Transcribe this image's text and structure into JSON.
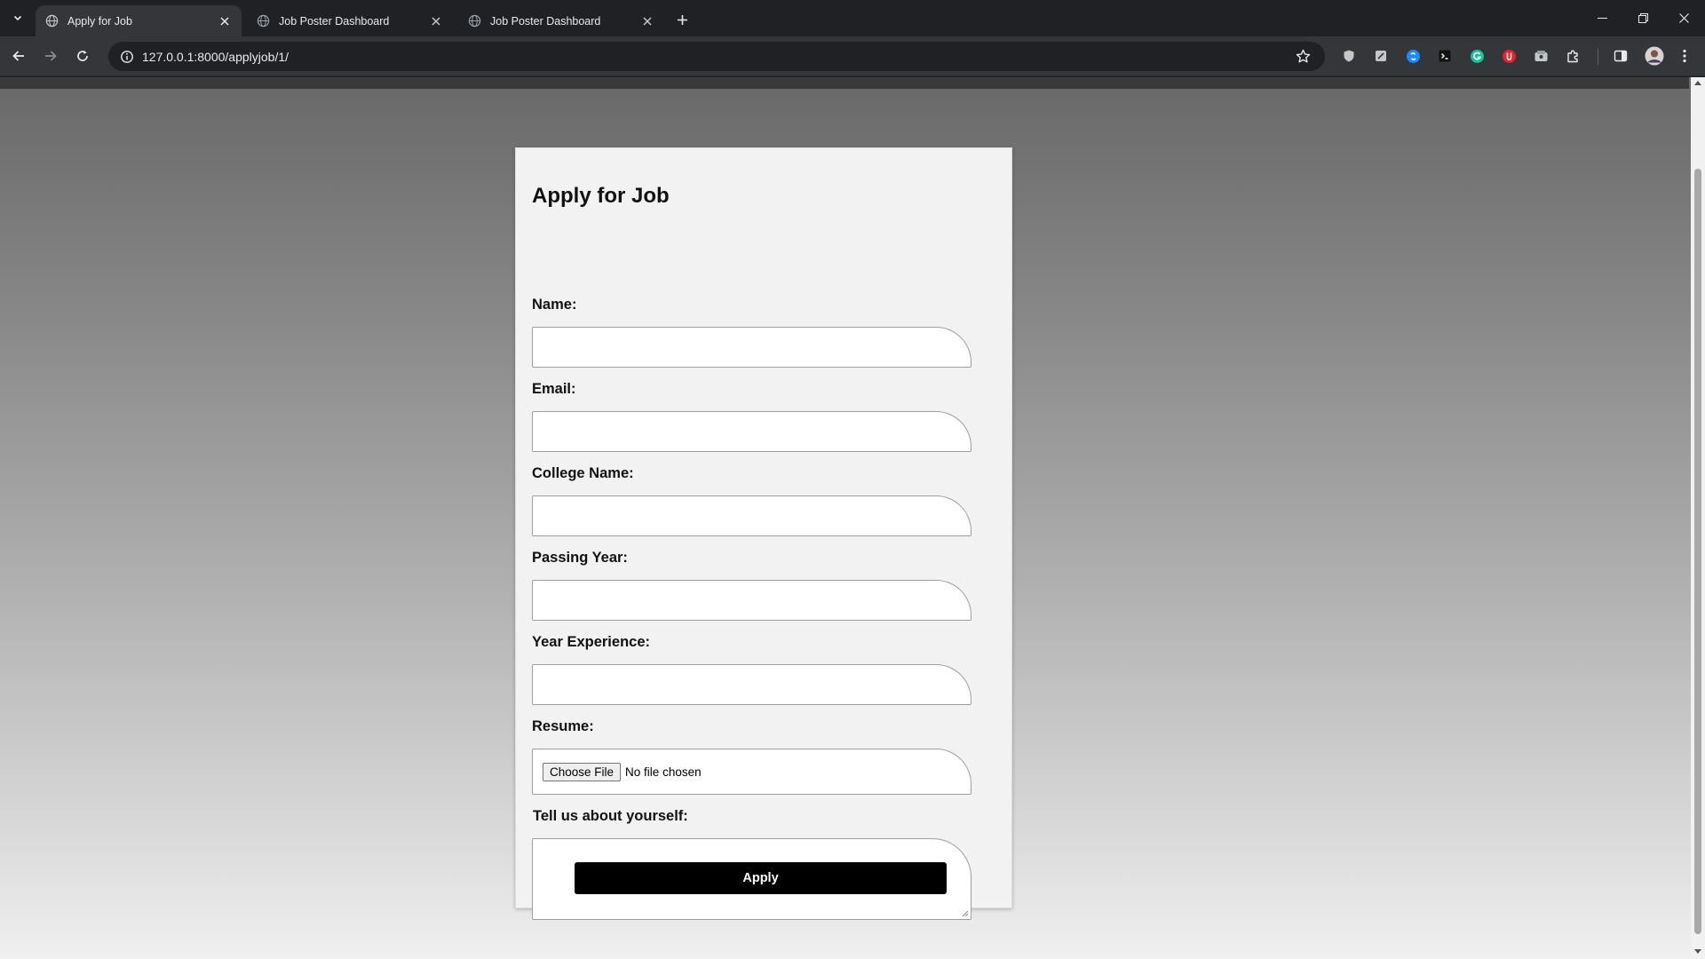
{
  "browser": {
    "tabs": [
      {
        "title": "Apply for Job",
        "active": true
      },
      {
        "title": "Job Poster Dashboard",
        "active": false
      },
      {
        "title": "Job Poster Dashboard",
        "active": false
      }
    ],
    "url": "127.0.0.1:8000/applyjob/1/"
  },
  "form": {
    "heading": "Apply for Job",
    "fields": [
      {
        "label": "Name:",
        "value": ""
      },
      {
        "label": "Email:",
        "value": ""
      },
      {
        "label": "College Name:",
        "value": ""
      },
      {
        "label": "Passing Year:",
        "value": ""
      },
      {
        "label": "Year Experience:",
        "value": ""
      }
    ],
    "resume": {
      "label": "Resume:",
      "button": "Choose File",
      "status": "No file chosen"
    },
    "about": {
      "label": "Tell us about yourself:",
      "value": ""
    },
    "submit_label": "Apply"
  },
  "colors": {
    "browser_frame": "#202124",
    "toolbar": "#35363a",
    "card": "#f2f2f2",
    "apply_button": "#000000"
  },
  "icons": {
    "tab_search": "chevron-down-icon",
    "favicon": "globe-icon",
    "extensions": [
      "shield-icon",
      "note-icon",
      "shazam-icon",
      "reader-icon",
      "grammarly-icon",
      "red-extension-icon",
      "translate-icon",
      "puzzle-icon"
    ]
  }
}
